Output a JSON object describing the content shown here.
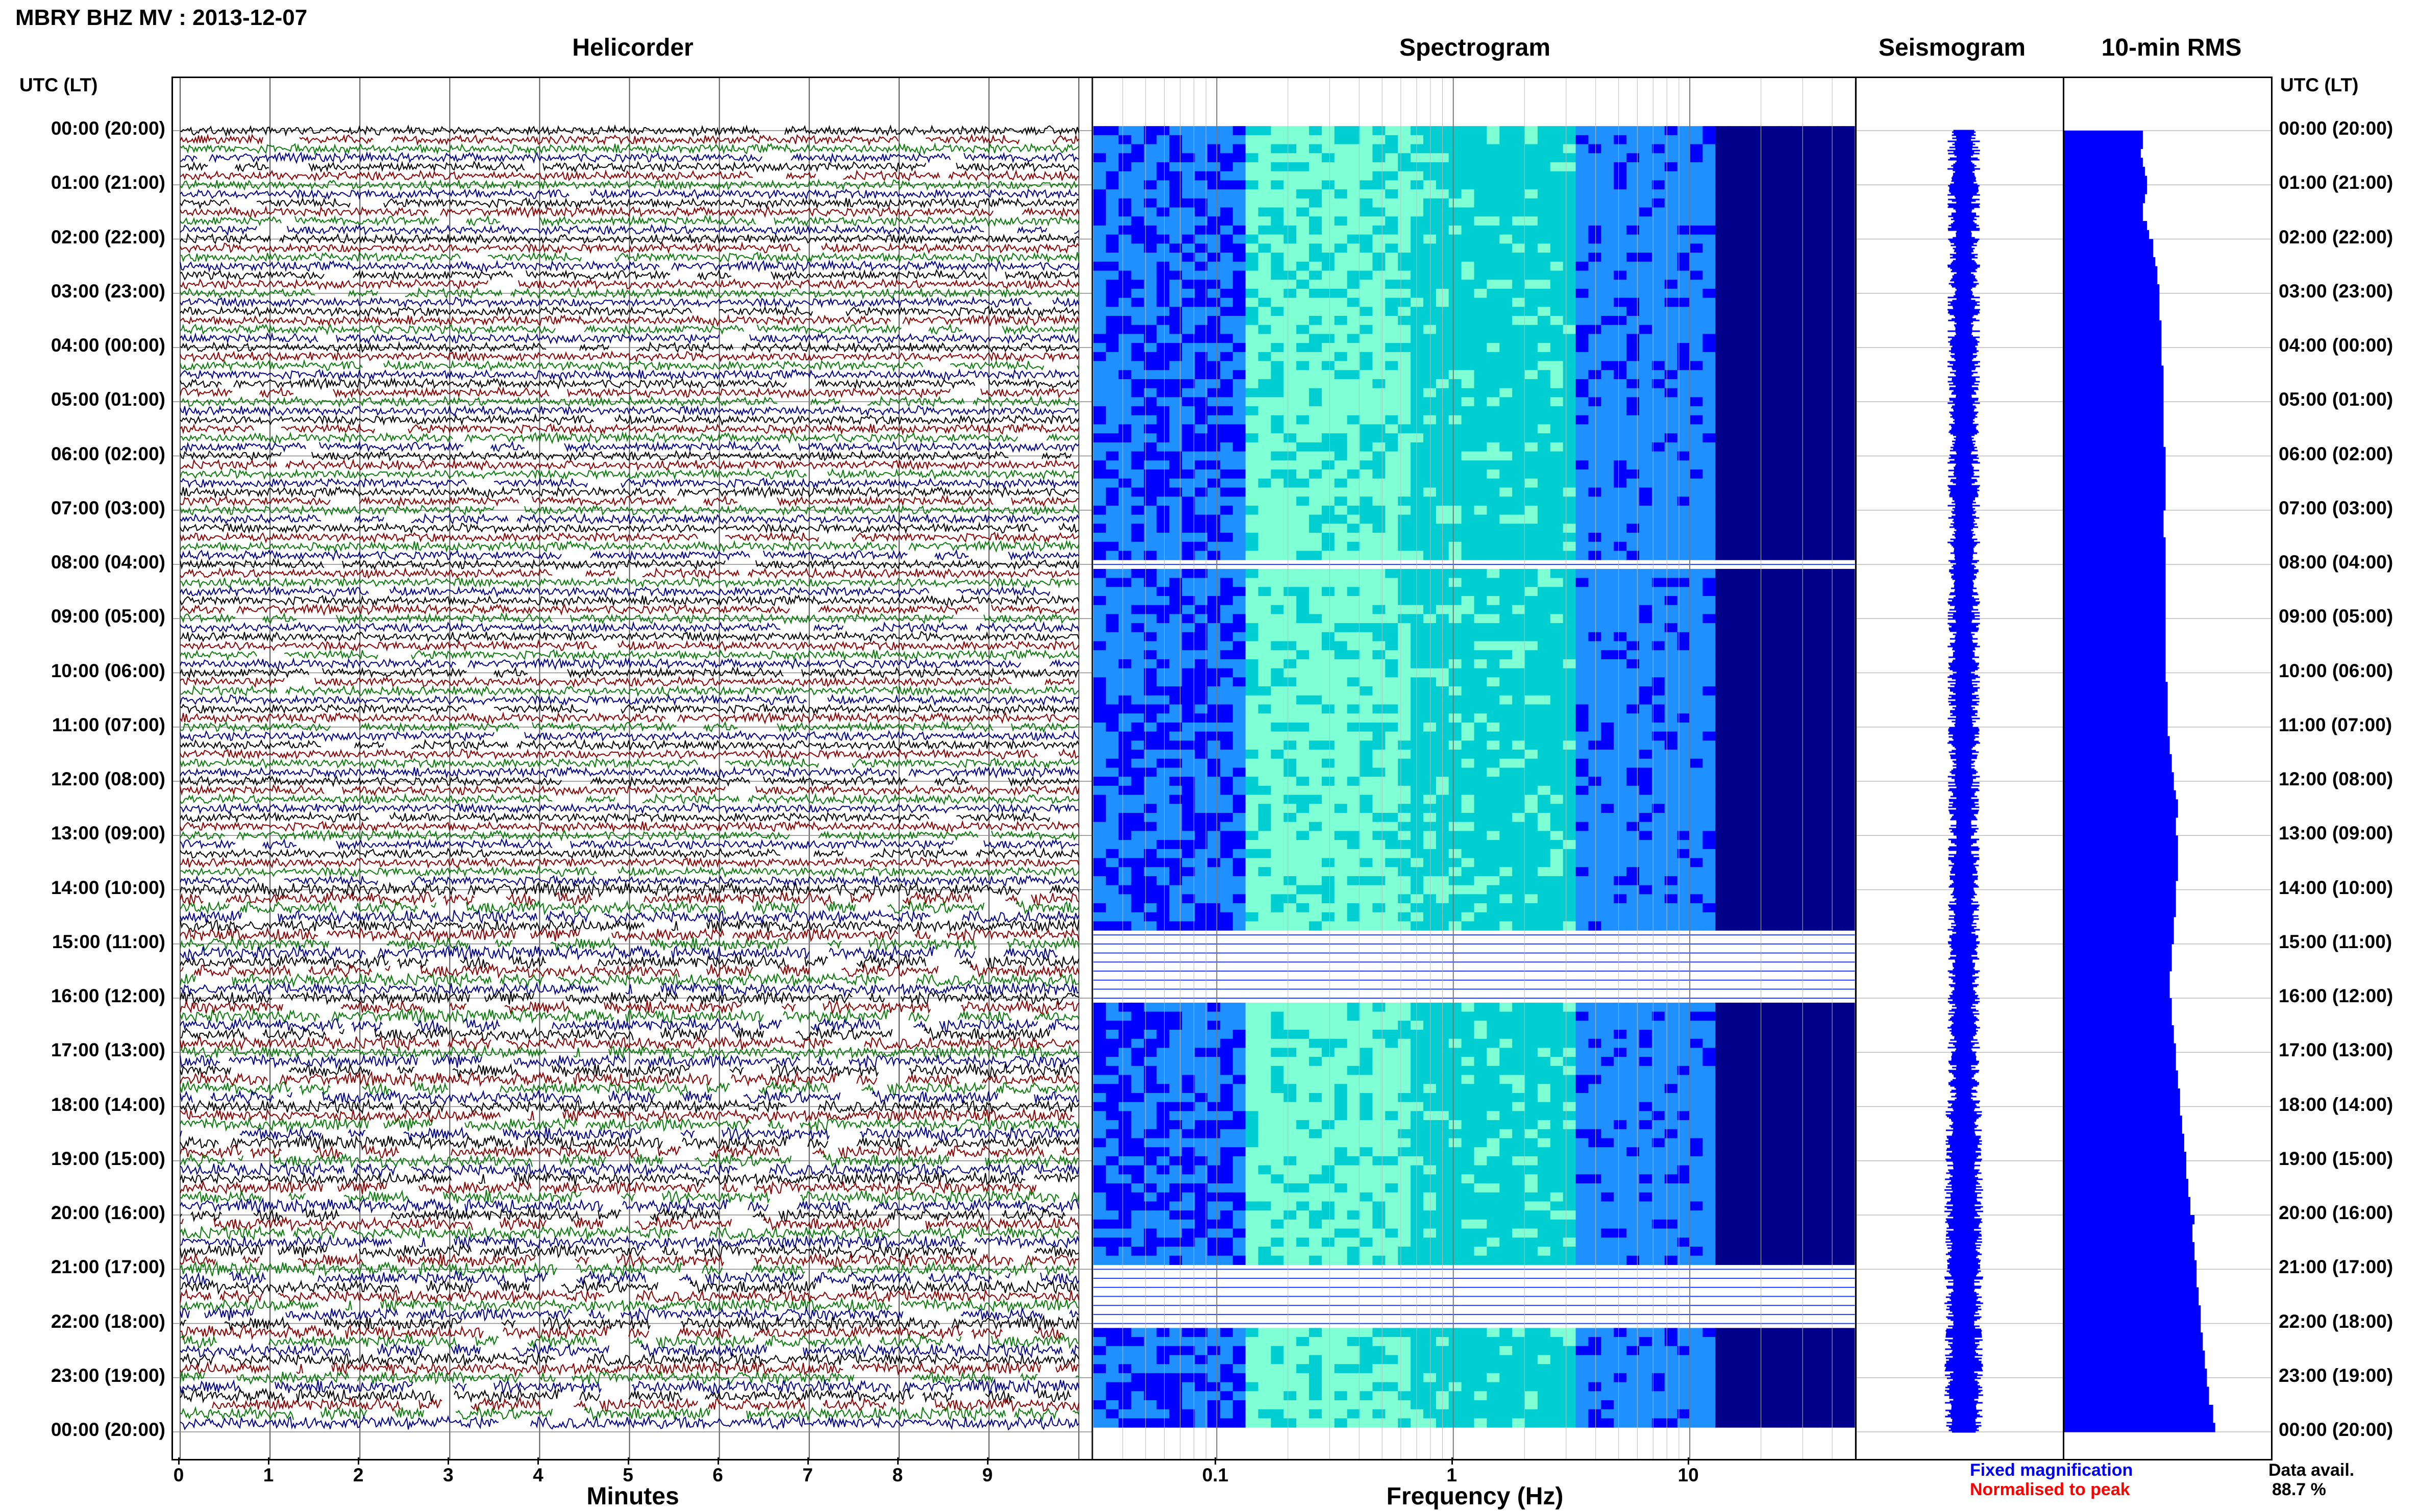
{
  "figure": {
    "title": "MBRY BHZ MV : 2013-12-07",
    "time_axis_label": "UTC (LT)",
    "data_avail_label": "Data avail.",
    "data_avail_value": "88.7 %",
    "legend_fixed": "Fixed magnification",
    "legend_normalised": "Normalised to peak",
    "colors": {
      "trace_cycle": [
        "#000000",
        "#8b0000",
        "#0a7a0a",
        "#00008b"
      ],
      "rms_bar": "#0000ff",
      "seismogram": "#0000ff",
      "legend_fixed": "#0000ff",
      "legend_normalised": "#ff0000",
      "spectrogram_colormap": [
        "#00008b",
        "#0000ff",
        "#1e90ff",
        "#00ced1",
        "#7fffd4",
        "#ffff66"
      ]
    }
  },
  "panels": {
    "helicorder": {
      "title": "Helicorder",
      "xlabel": "Minutes"
    },
    "spectrogram": {
      "title": "Spectrogram",
      "xlabel": "Frequency (Hz)"
    },
    "seismogram": {
      "title": "Seismogram"
    },
    "rms": {
      "title": "10-min RMS"
    }
  },
  "time_labels": [
    "00:00 (20:00)",
    "01:00 (21:00)",
    "02:00 (22:00)",
    "03:00 (23:00)",
    "04:00 (00:00)",
    "05:00 (01:00)",
    "06:00 (02:00)",
    "07:00 (03:00)",
    "08:00 (04:00)",
    "09:00 (05:00)",
    "10:00 (06:00)",
    "11:00 (07:00)",
    "12:00 (08:00)",
    "13:00 (09:00)",
    "14:00 (10:00)",
    "15:00 (11:00)",
    "16:00 (12:00)",
    "17:00 (13:00)",
    "18:00 (14:00)",
    "19:00 (15:00)",
    "20:00 (16:00)",
    "21:00 (17:00)",
    "22:00 (18:00)",
    "23:00 (19:00)",
    "00:00 (20:00)"
  ],
  "chart_data": [
    {
      "type": "line",
      "panel": "helicorder",
      "title": "Helicorder",
      "xlabel": "Minutes",
      "ylabel": "UTC (LT)",
      "x_ticks": [
        "0",
        "1",
        "2",
        "3",
        "4",
        "5",
        "6",
        "7",
        "8",
        "9"
      ],
      "xlim": [
        0,
        10
      ],
      "rows_per_hour": 6,
      "total_rows": 144
    },
    {
      "type": "heatmap",
      "panel": "spectrogram",
      "title": "Spectrogram",
      "xlabel": "Frequency (Hz)",
      "x_scale": "log",
      "x_ticks": [
        "0.1",
        "1",
        "10"
      ],
      "xlim": [
        0.03,
        50
      ],
      "row_activity_10min": [
        1,
        1,
        1,
        1,
        1,
        1,
        1,
        1,
        1,
        1,
        1,
        1,
        1,
        1,
        1,
        1,
        1,
        1,
        1,
        1,
        1,
        1,
        1,
        1,
        1,
        1,
        1,
        1,
        1,
        1,
        1,
        1,
        1,
        1,
        1,
        1,
        1,
        1,
        1,
        1,
        1,
        1,
        1,
        1,
        1,
        1,
        1,
        1,
        0,
        1,
        1,
        1,
        1,
        1,
        1,
        1,
        1,
        1,
        1,
        1,
        1,
        1,
        1,
        1,
        1,
        1,
        1,
        1,
        1,
        1,
        1,
        1,
        1,
        1,
        1,
        1,
        1,
        1,
        1,
        1,
        1,
        1,
        1,
        1,
        1,
        1,
        1,
        1,
        1,
        0,
        0,
        0,
        0,
        0,
        0,
        0,
        0,
        1,
        1,
        1,
        1,
        1,
        1,
        1,
        1,
        1,
        1,
        1,
        1,
        1,
        1,
        1,
        1,
        1,
        1,
        1,
        1,
        1,
        1,
        1,
        1,
        1,
        1,
        1,
        1,
        1,
        0,
        0,
        0,
        0,
        0,
        0,
        0,
        1,
        1,
        1,
        1,
        1,
        1,
        1,
        1,
        1,
        1,
        1
      ]
    },
    {
      "type": "line",
      "panel": "seismogram",
      "title": "Seismogram"
    },
    {
      "type": "bar",
      "panel": "rms",
      "title": "10-min RMS",
      "orientation": "horizontal",
      "values_relative": [
        0.38,
        0.38,
        0.37,
        0.38,
        0.39,
        0.4,
        0.4,
        0.39,
        0.38,
        0.38,
        0.4,
        0.41,
        0.43,
        0.43,
        0.44,
        0.45,
        0.45,
        0.46,
        0.46,
        0.46,
        0.46,
        0.47,
        0.47,
        0.47,
        0.47,
        0.47,
        0.48,
        0.48,
        0.48,
        0.48,
        0.48,
        0.48,
        0.48,
        0.48,
        0.48,
        0.49,
        0.49,
        0.49,
        0.49,
        0.49,
        0.49,
        0.49,
        0.48,
        0.48,
        0.48,
        0.49,
        0.49,
        0.49,
        0.49,
        0.49,
        0.49,
        0.49,
        0.49,
        0.49,
        0.49,
        0.49,
        0.49,
        0.49,
        0.49,
        0.49,
        0.49,
        0.5,
        0.5,
        0.5,
        0.5,
        0.5,
        0.5,
        0.51,
        0.51,
        0.52,
        0.52,
        0.53,
        0.53,
        0.54,
        0.55,
        0.55,
        0.54,
        0.54,
        0.55,
        0.55,
        0.55,
        0.55,
        0.55,
        0.54,
        0.54,
        0.54,
        0.54,
        0.53,
        0.53,
        0.53,
        0.52,
        0.52,
        0.52,
        0.51,
        0.51,
        0.51,
        0.52,
        0.52,
        0.52,
        0.53,
        0.53,
        0.54,
        0.54,
        0.54,
        0.55,
        0.55,
        0.56,
        0.56,
        0.56,
        0.57,
        0.57,
        0.58,
        0.58,
        0.59,
        0.59,
        0.59,
        0.6,
        0.6,
        0.61,
        0.61,
        0.63,
        0.62,
        0.62,
        0.63,
        0.63,
        0.64,
        0.64,
        0.64,
        0.65,
        0.65,
        0.66,
        0.66,
        0.66,
        0.67,
        0.67,
        0.68,
        0.68,
        0.69,
        0.69,
        0.7,
        0.7,
        0.72,
        0.72,
        0.73
      ]
    }
  ]
}
